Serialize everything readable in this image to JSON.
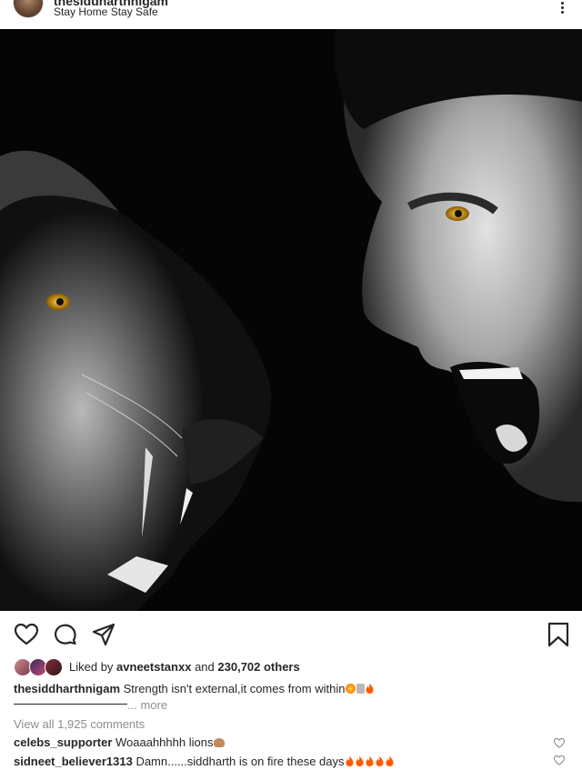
{
  "post": {
    "username": "thesiddharthnigam",
    "location": "Stay Home Stay Safe"
  },
  "icons": {
    "more": "more-vertical-icon",
    "like": "heart-icon",
    "comment": "comment-icon",
    "share": "send-icon",
    "save": "bookmark-icon"
  },
  "likes": {
    "prefix": "Liked by",
    "user": "avneetstanxx",
    "joiner": "and",
    "others": "230,702 others"
  },
  "caption": {
    "username": "thesiddharthnigam",
    "text": "Strength isn't external,it comes from within",
    "more": "... more"
  },
  "view_all": "View all 1,925 comments",
  "comments": [
    {
      "username": "celebs_supporter",
      "text": "Woaaahhhhh lions"
    },
    {
      "username": "sidneet_believer1313",
      "text": "Damn......siddharth is on fire these days"
    }
  ],
  "colors": {
    "text": "#262626",
    "muted": "#8e8e8e",
    "fire": "#ff5a00"
  }
}
